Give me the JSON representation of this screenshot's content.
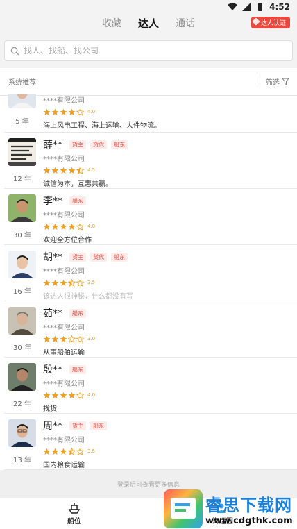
{
  "status_bar": {
    "time": "4:52"
  },
  "top_nav": {
    "tabs": [
      {
        "label": "收藏"
      },
      {
        "label": "达人"
      },
      {
        "label": "通话"
      }
    ],
    "cert_badge": "达人认证"
  },
  "search": {
    "placeholder": "找人、找船、找公司"
  },
  "filter_bar": {
    "section_title": "系统推荐",
    "filter_label": "筛选"
  },
  "colors": {
    "accent": "#e8483e",
    "star": "#f0a020"
  },
  "experts": [
    {
      "name": "",
      "tags": [],
      "company": "****有限公司",
      "rating": 4.0,
      "score_label": "4.0",
      "years": "5 年",
      "desc": "海上风电工程、海上运输、大件物流。",
      "avatar": "man-white-shirt",
      "muted": false
    },
    {
      "name": "薛**",
      "tags": [
        "货主",
        "货代",
        "船东"
      ],
      "company": "****有限公司",
      "rating": 4.5,
      "score_label": "4.5",
      "years": "12 年",
      "desc": "诚信为本，互惠共赢。",
      "avatar": "calligraphy",
      "muted": false
    },
    {
      "name": "李**",
      "tags": [
        "船东"
      ],
      "company": "****有限公司",
      "rating": 4.0,
      "score_label": "4.0",
      "years": "30 年",
      "desc": "欢迎全方位合作",
      "avatar": "man-outdoor",
      "muted": false
    },
    {
      "name": "胡**",
      "tags": [
        "货主",
        "货代",
        "船东"
      ],
      "company": "****有限公司",
      "rating": 3.5,
      "score_label": "3.5",
      "years": "16 年",
      "desc": "该达人很神秘，什么都没有写",
      "avatar": "man-suit",
      "muted": true
    },
    {
      "name": "茹**",
      "tags": [
        "船东"
      ],
      "company": "****有限公司",
      "rating": 3.0,
      "score_label": "3.0",
      "years": "30 年",
      "desc": "从事船舶运输",
      "avatar": "man-older",
      "muted": false
    },
    {
      "name": "殷**",
      "tags": [
        "船东"
      ],
      "company": "****有限公司",
      "rating": 4.0,
      "score_label": "4.0",
      "years": "22 年",
      "desc": "找货",
      "avatar": "man-dark",
      "muted": false
    },
    {
      "name": "周**",
      "tags": [
        "货主",
        "船东"
      ],
      "company": "****有限公司",
      "rating": 3.5,
      "score_label": "3.5",
      "years": "13 年",
      "desc": "国内粮食运输",
      "avatar": "man-glasses",
      "muted": false
    }
  ],
  "login_tip": "登录后可查看更多信息",
  "bottom_nav": [
    {
      "label": "船位",
      "icon": "ship-icon"
    },
    {
      "label": "海运圈",
      "icon": "people-icon"
    }
  ],
  "watermark": {
    "title": "睿思下载网",
    "url": "www.cdgthk.com"
  }
}
